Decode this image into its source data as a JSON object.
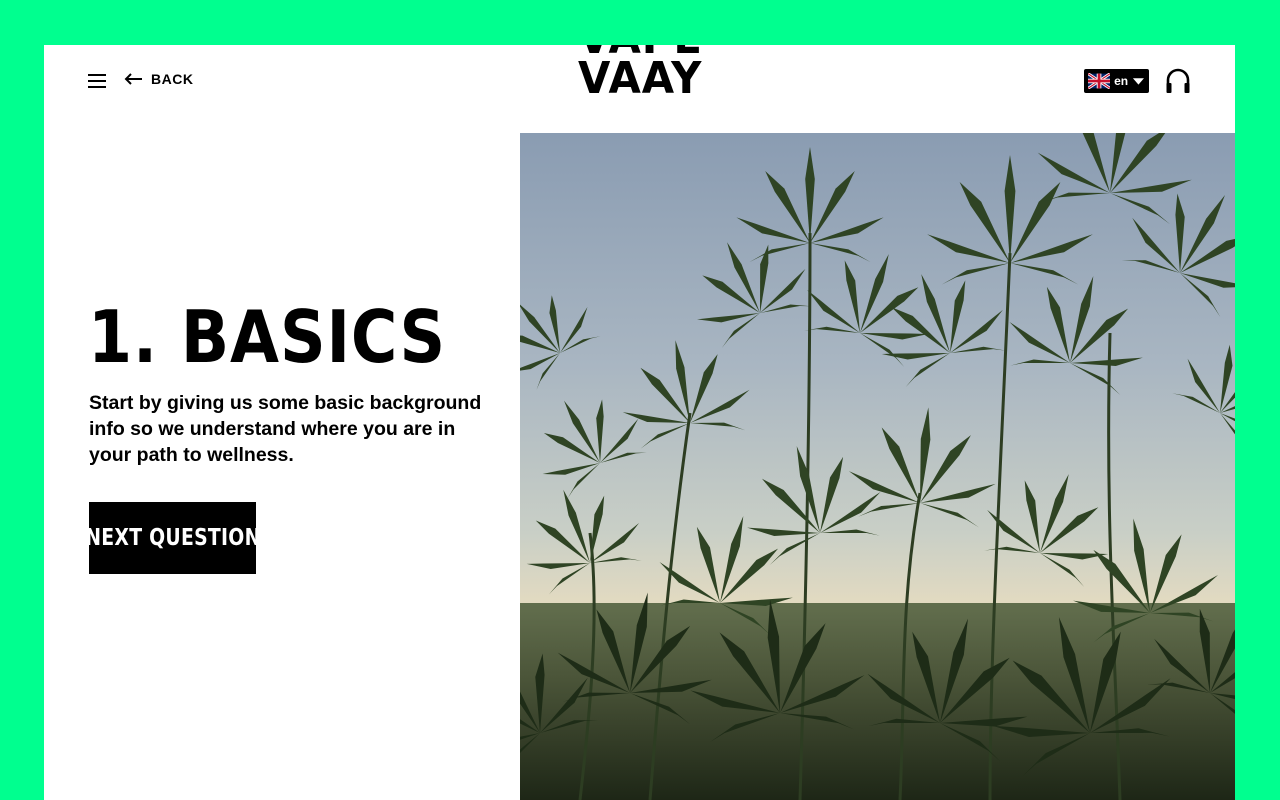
{
  "header": {
    "menu_icon": "hamburger-menu-icon",
    "back_label": "BACK",
    "back_icon": "arrow-left-icon",
    "logo_line1": "VAPE",
    "logo_line2": "VAAY",
    "language": {
      "selected": "en",
      "flag_icon": "uk-flag-icon",
      "caret_icon": "caret-down-icon"
    },
    "audio_icon": "headphones-icon"
  },
  "main": {
    "title": "1. BASICS",
    "description": "Start by giving us some basic background info so we understand where you are in your path to wellness.",
    "next_button_label": "NEXT QUESTION"
  },
  "hero_image": {
    "subject": "cannabis plants against a dusk sky"
  },
  "colors": {
    "accent_border": "#00ff8f",
    "background": "#ffffff",
    "text": "#000000",
    "button_bg": "#000000",
    "button_text": "#ffffff"
  }
}
